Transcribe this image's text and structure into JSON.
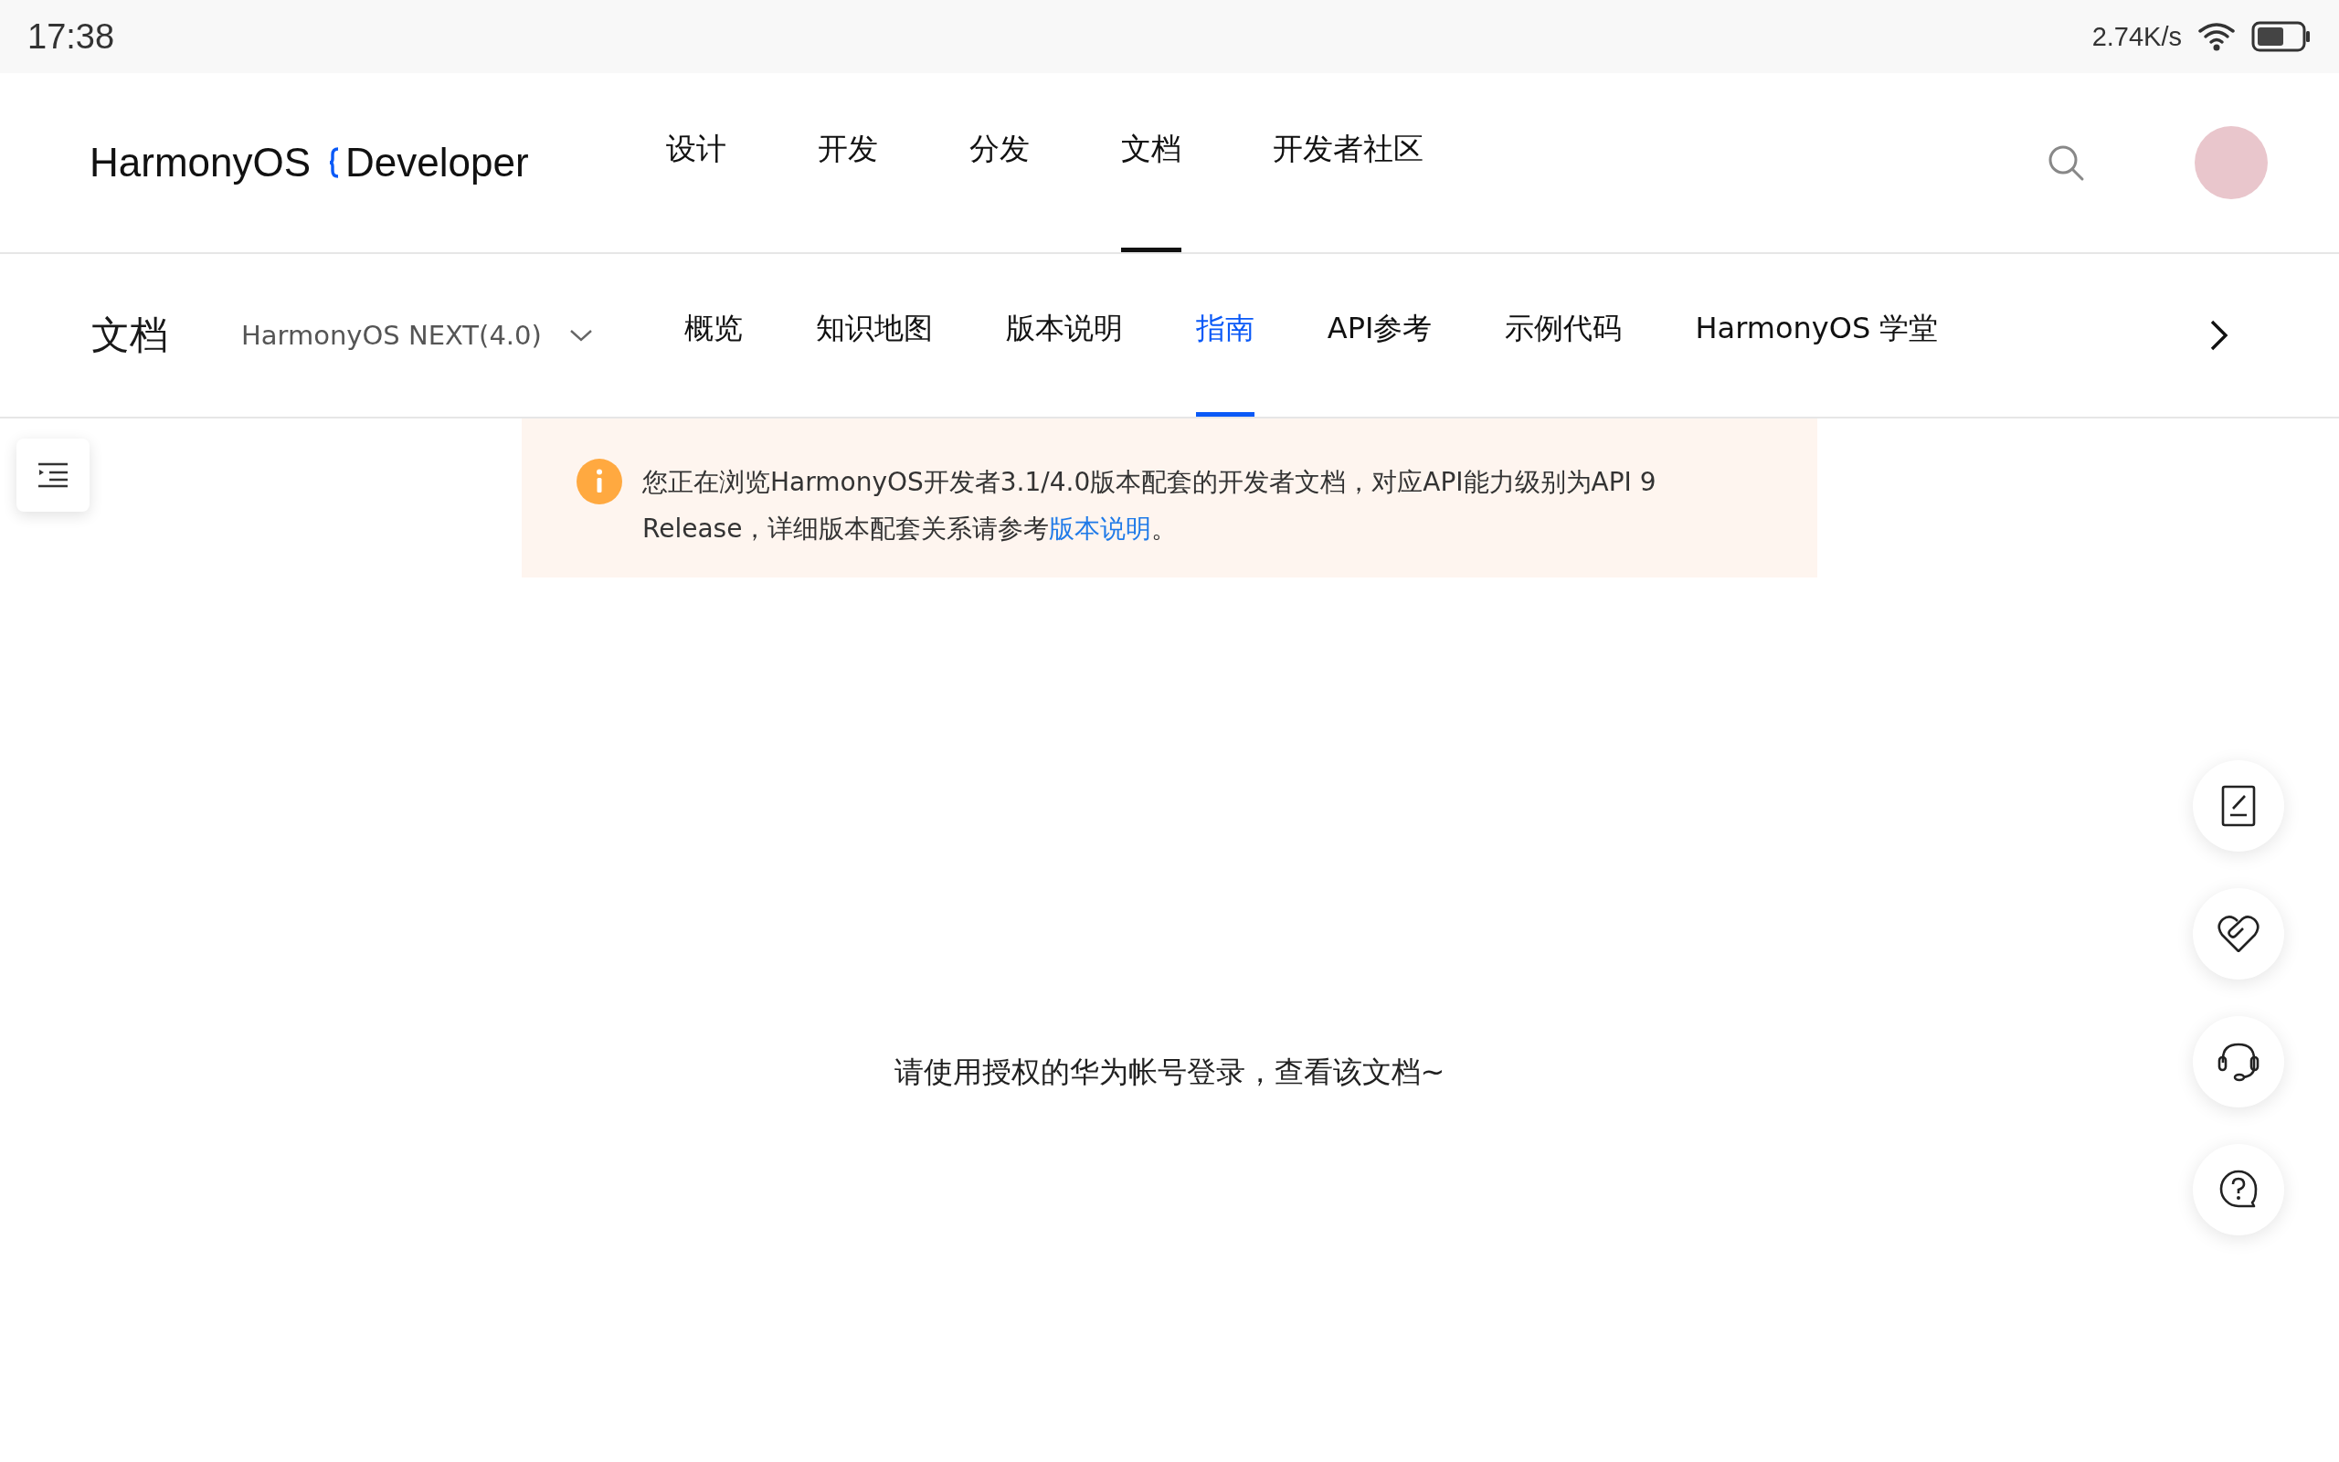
{
  "status_bar": {
    "time": "17:38",
    "speed": "2.74K/s"
  },
  "header": {
    "logo": {
      "brand": "HarmonyOS",
      "product": "Developer"
    },
    "nav": [
      {
        "label": "设计",
        "selected": false
      },
      {
        "label": "开发",
        "selected": false
      },
      {
        "label": "分发",
        "selected": false
      },
      {
        "label": "文档",
        "selected": true
      },
      {
        "label": "开发者社区",
        "selected": false
      }
    ]
  },
  "subnav": {
    "title": "文档",
    "version": "HarmonyOS NEXT(4.0)",
    "tabs": [
      {
        "label": "概览",
        "selected": false
      },
      {
        "label": "知识地图",
        "selected": false
      },
      {
        "label": "版本说明",
        "selected": false
      },
      {
        "label": "指南",
        "selected": true
      },
      {
        "label": "API参考",
        "selected": false
      },
      {
        "label": "示例代码",
        "selected": false
      },
      {
        "label": "HarmonyOS 学堂",
        "selected": false
      }
    ]
  },
  "notice": {
    "text": "您正在浏览HarmonyOS开发者3.1/4.0版本配套的开发者文档，对应API能力级别为API 9 Release，详细版本配套关系请参考",
    "link": "版本说明",
    "suffix": "。"
  },
  "message": "请使用授权的华为帐号登录，查看该文档~"
}
